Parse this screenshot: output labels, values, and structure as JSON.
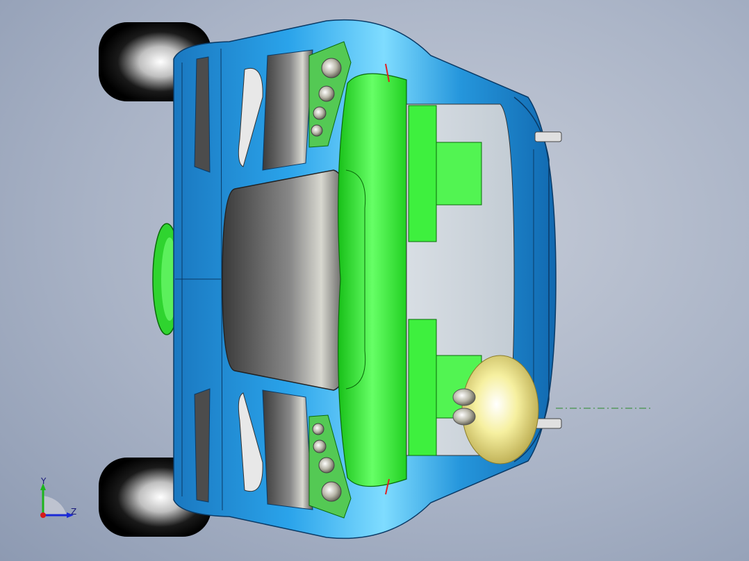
{
  "viewport": {
    "background_top": "#c6ccd8",
    "background_bottom": "#8d9ab2"
  },
  "model": {
    "body_color": "#1f8fd6",
    "body_highlight": "#6fd2ff",
    "hood_color": "#6b6b6b",
    "accent_green": "#2ee62e",
    "glass_color": "#cfd7de",
    "tire_color": "#050505",
    "lamp_color": "#d8d4c4",
    "light_bulb_color": "#f5ef9a"
  },
  "triad": {
    "y_label": "Y",
    "z_label": "Z",
    "y_color": "#1db51d",
    "z_color": "#1a2ad6",
    "x_color": "#d61a1a"
  }
}
